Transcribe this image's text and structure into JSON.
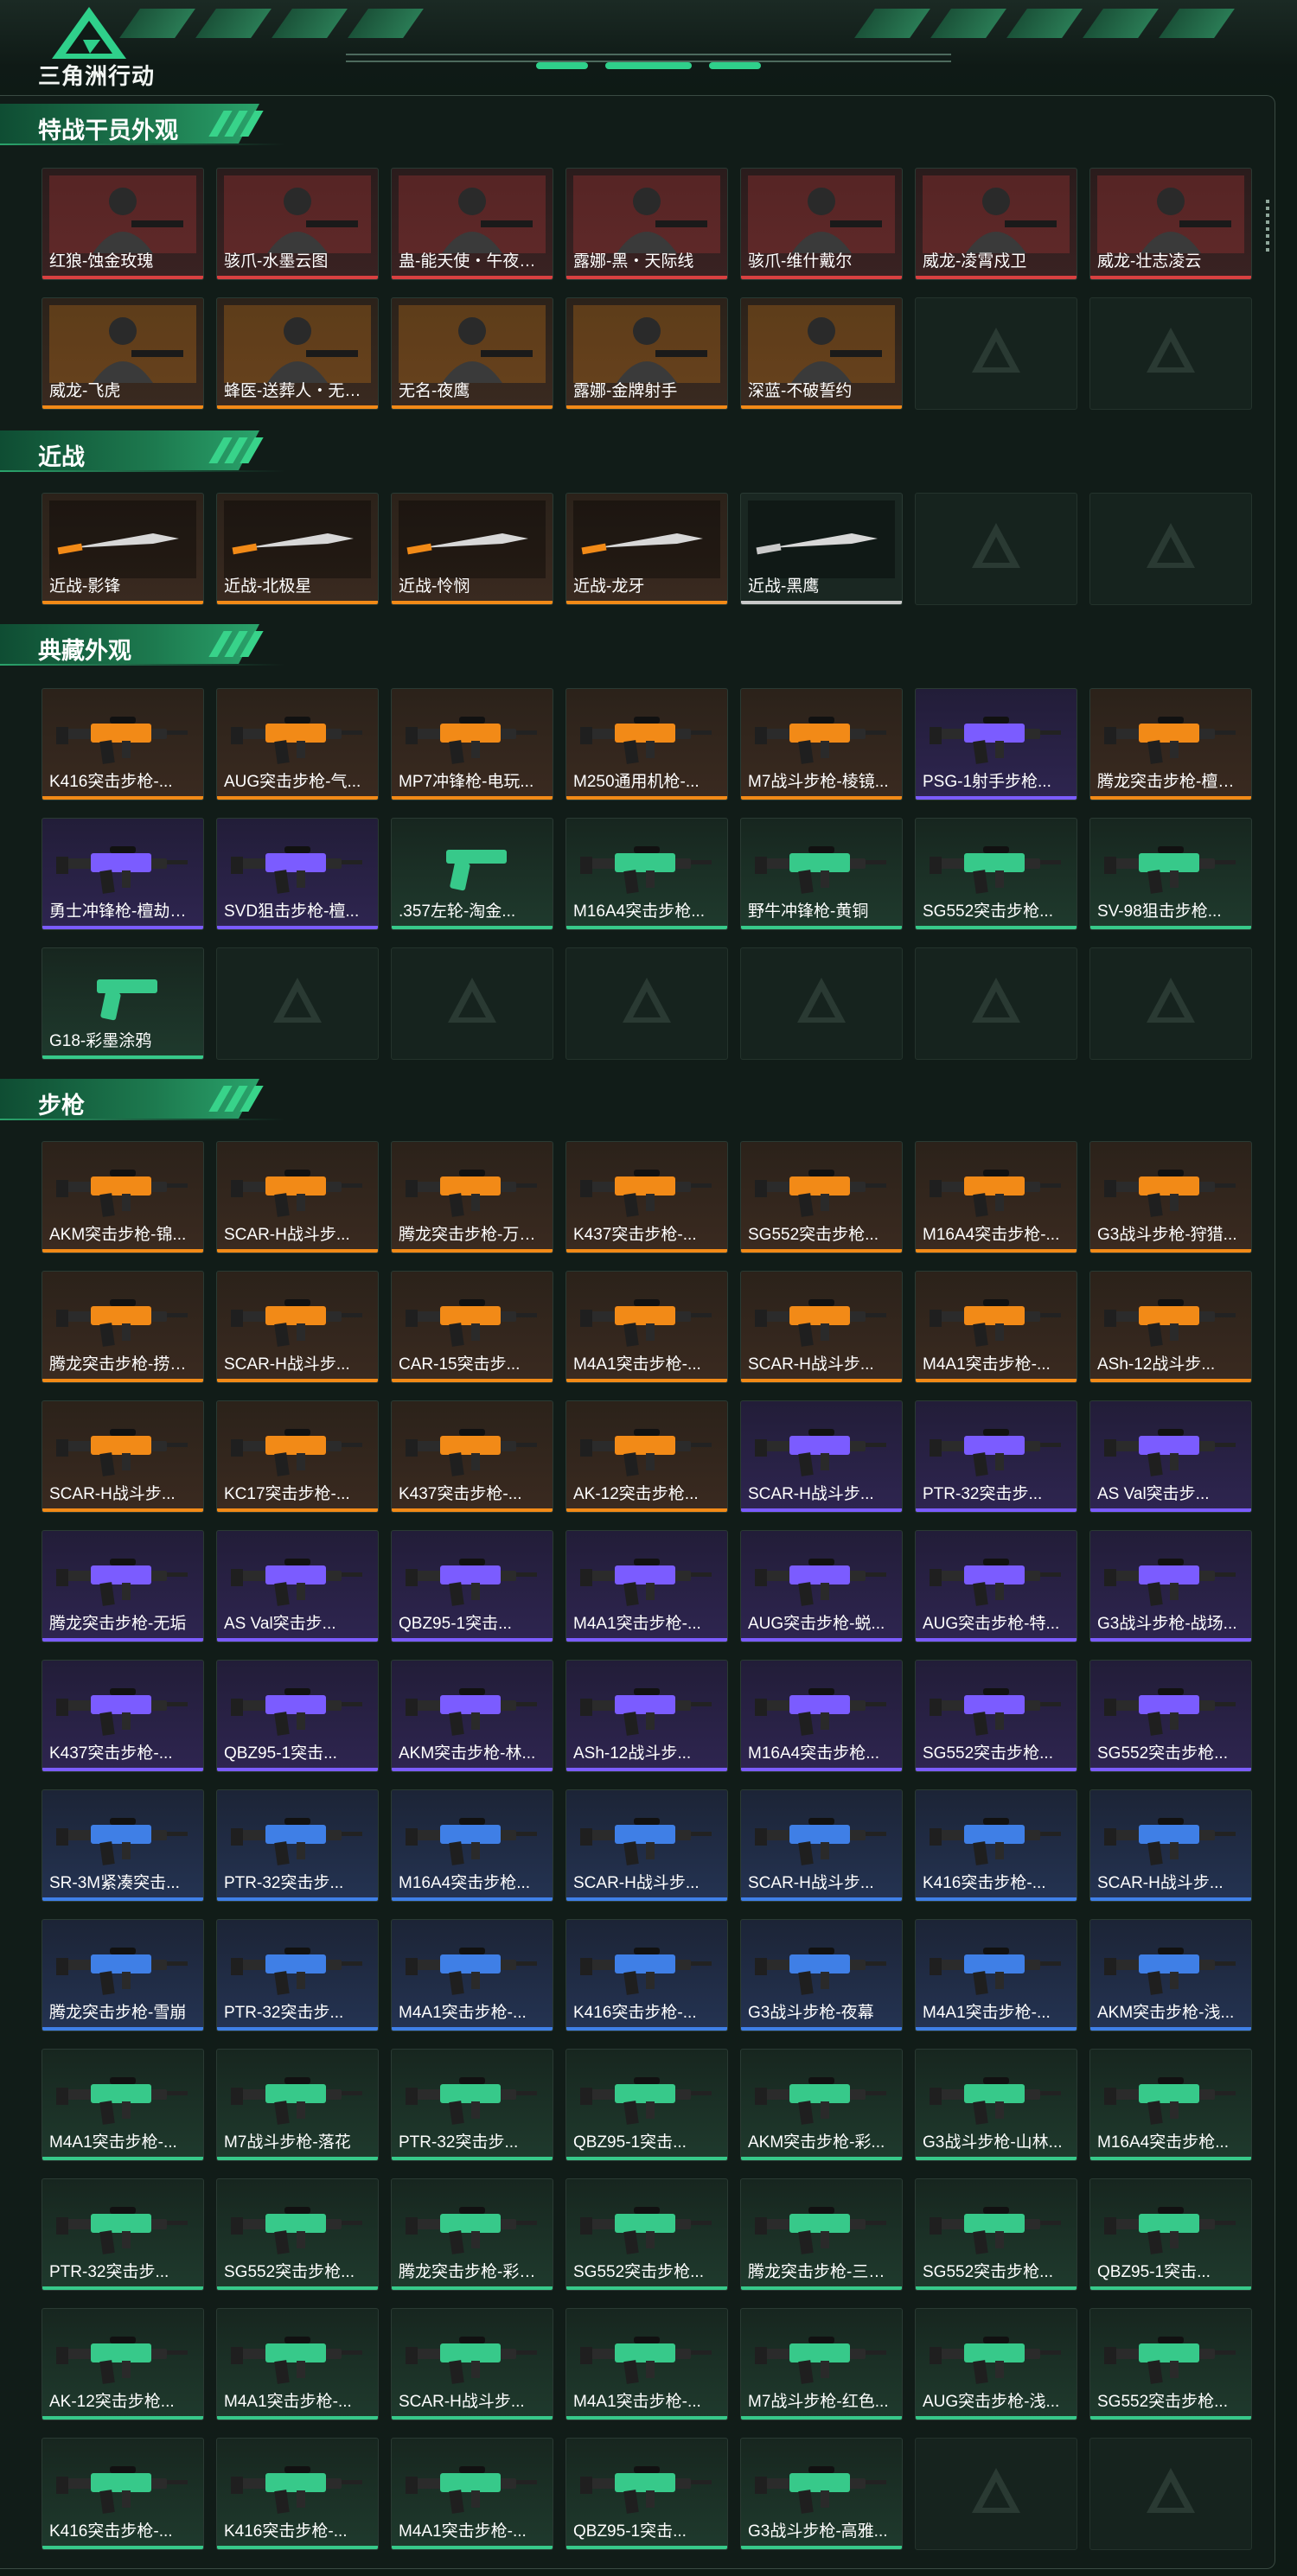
{
  "header": {
    "logo_text": "三角洲行动",
    "accent_color": "#2fd08b"
  },
  "sections": [
    {
      "key": "operators",
      "title": "特战干员外观",
      "items": [
        {
          "name": "红狼-蚀金玫瑰",
          "rarity": "red",
          "icon": "operator-portrait"
        },
        {
          "name": "骇爪-水墨云图",
          "rarity": "red",
          "icon": "operator-portrait"
        },
        {
          "name": "蛊-能天使・午夜邮...",
          "rarity": "red",
          "icon": "operator-portrait"
        },
        {
          "name": "露娜-黑・天际线",
          "rarity": "red",
          "icon": "operator-portrait"
        },
        {
          "name": "骇爪-维什戴尔",
          "rarity": "red",
          "icon": "operator-portrait"
        },
        {
          "name": "威龙-凌霄戍卫",
          "rarity": "red",
          "icon": "operator-portrait"
        },
        {
          "name": "威龙-壮志凌云",
          "rarity": "red",
          "icon": "operator-portrait"
        },
        {
          "name": "威龙-飞虎",
          "rarity": "gold",
          "icon": "operator-portrait"
        },
        {
          "name": "蜂医-送葬人・无题...",
          "rarity": "gold",
          "icon": "operator-portrait"
        },
        {
          "name": "无名-夜鹰",
          "rarity": "gold",
          "icon": "operator-portrait"
        },
        {
          "name": "露娜-金牌射手",
          "rarity": "gold",
          "icon": "operator-portrait"
        },
        {
          "name": "深蓝-不破誓约",
          "rarity": "gold",
          "icon": "operator-portrait"
        },
        {
          "empty": true
        },
        {
          "empty": true
        }
      ]
    },
    {
      "key": "melee",
      "title": "近战",
      "items": [
        {
          "name": "近战-影锋",
          "rarity": "gold",
          "icon": "knife"
        },
        {
          "name": "近战-北极星",
          "rarity": "gold",
          "icon": "knife"
        },
        {
          "name": "近战-怜悯",
          "rarity": "gold",
          "icon": "knife"
        },
        {
          "name": "近战-龙牙",
          "rarity": "gold",
          "icon": "knife"
        },
        {
          "name": "近战-黑鹰",
          "rarity": "gray",
          "icon": "knife"
        },
        {
          "empty": true
        },
        {
          "empty": true
        }
      ]
    },
    {
      "key": "collection",
      "title": "典藏外观",
      "items": [
        {
          "name": "K416突击步枪-...",
          "rarity": "gold",
          "icon": "rifle"
        },
        {
          "name": "AUG突击步枪-气...",
          "rarity": "gold",
          "icon": "rifle"
        },
        {
          "name": "MP7冲锋枪-电玩...",
          "rarity": "gold",
          "icon": "rifle"
        },
        {
          "name": "M250通用机枪-...",
          "rarity": "gold",
          "icon": "rifle"
        },
        {
          "name": "M7战斗步枪-棱镜...",
          "rarity": "gold",
          "icon": "rifle"
        },
        {
          "name": "PSG-1射手步枪...",
          "rarity": "purple",
          "icon": "rifle"
        },
        {
          "name": "腾龙突击步枪-檀劫...",
          "rarity": "gold",
          "icon": "rifle"
        },
        {
          "name": "勇士冲锋枪-檀劫镜...",
          "rarity": "purple",
          "icon": "rifle"
        },
        {
          "name": "SVD狙击步枪-檀...",
          "rarity": "purple",
          "icon": "rifle"
        },
        {
          "name": ".357左轮-淘金...",
          "rarity": "green",
          "icon": "revolver"
        },
        {
          "name": "M16A4突击步枪...",
          "rarity": "green",
          "icon": "rifle"
        },
        {
          "name": "野牛冲锋枪-黄铜",
          "rarity": "green",
          "icon": "rifle"
        },
        {
          "name": "SG552突击步枪...",
          "rarity": "green",
          "icon": "rifle"
        },
        {
          "name": "SV-98狙击步枪...",
          "rarity": "green",
          "icon": "rifle"
        },
        {
          "name": "G18-彩墨涂鸦",
          "rarity": "green",
          "icon": "pistol"
        },
        {
          "empty": true
        },
        {
          "empty": true
        },
        {
          "empty": true
        },
        {
          "empty": true
        },
        {
          "empty": true
        },
        {
          "empty": true
        }
      ]
    },
    {
      "key": "rifles",
      "title": "步枪",
      "items": [
        {
          "name": "AKM突击步枪-锦...",
          "rarity": "gold",
          "icon": "rifle"
        },
        {
          "name": "SCAR-H战斗步...",
          "rarity": "gold",
          "icon": "rifle"
        },
        {
          "name": "腾龙突击步枪-万金...",
          "rarity": "gold",
          "icon": "rifle"
        },
        {
          "name": "K437突击步枪-...",
          "rarity": "gold",
          "icon": "rifle"
        },
        {
          "name": "SG552突击步枪...",
          "rarity": "gold",
          "icon": "rifle"
        },
        {
          "name": "M16A4突击步枪-...",
          "rarity": "gold",
          "icon": "rifle"
        },
        {
          "name": "G3战斗步枪-狩猎...",
          "rarity": "gold",
          "icon": "rifle"
        },
        {
          "name": "腾龙突击步枪-捞点...",
          "rarity": "gold",
          "icon": "rifle"
        },
        {
          "name": "SCAR-H战斗步...",
          "rarity": "gold",
          "icon": "rifle"
        },
        {
          "name": "CAR-15突击步...",
          "rarity": "gold",
          "icon": "rifle"
        },
        {
          "name": "M4A1突击步枪-...",
          "rarity": "gold",
          "icon": "rifle"
        },
        {
          "name": "SCAR-H战斗步...",
          "rarity": "gold",
          "icon": "rifle"
        },
        {
          "name": "M4A1突击步枪-...",
          "rarity": "gold",
          "icon": "rifle"
        },
        {
          "name": "ASh-12战斗步...",
          "rarity": "gold",
          "icon": "rifle"
        },
        {
          "name": "SCAR-H战斗步...",
          "rarity": "gold",
          "icon": "rifle"
        },
        {
          "name": "KC17突击步枪-...",
          "rarity": "gold",
          "icon": "rifle"
        },
        {
          "name": "K437突击步枪-...",
          "rarity": "gold",
          "icon": "rifle"
        },
        {
          "name": "AK-12突击步枪...",
          "rarity": "gold",
          "icon": "rifle"
        },
        {
          "name": "SCAR-H战斗步...",
          "rarity": "purple",
          "icon": "rifle"
        },
        {
          "name": "PTR-32突击步...",
          "rarity": "purple",
          "icon": "rifle"
        },
        {
          "name": "AS Val突击步...",
          "rarity": "purple",
          "icon": "rifle"
        },
        {
          "name": "腾龙突击步枪-无垢",
          "rarity": "purple",
          "icon": "rifle"
        },
        {
          "name": "AS Val突击步...",
          "rarity": "purple",
          "icon": "rifle"
        },
        {
          "name": "QBZ95-1突击...",
          "rarity": "purple",
          "icon": "rifle"
        },
        {
          "name": "M4A1突击步枪-...",
          "rarity": "purple",
          "icon": "rifle"
        },
        {
          "name": "AUG突击步枪-蜕...",
          "rarity": "purple",
          "icon": "rifle"
        },
        {
          "name": "AUG突击步枪-特...",
          "rarity": "purple",
          "icon": "rifle"
        },
        {
          "name": "G3战斗步枪-战场...",
          "rarity": "purple",
          "icon": "rifle"
        },
        {
          "name": "K437突击步枪-...",
          "rarity": "purple",
          "icon": "rifle"
        },
        {
          "name": "QBZ95-1突击...",
          "rarity": "purple",
          "icon": "rifle"
        },
        {
          "name": "AKM突击步枪-林...",
          "rarity": "purple",
          "icon": "rifle"
        },
        {
          "name": "ASh-12战斗步...",
          "rarity": "purple",
          "icon": "rifle"
        },
        {
          "name": "M16A4突击步枪...",
          "rarity": "purple",
          "icon": "rifle"
        },
        {
          "name": "SG552突击步枪...",
          "rarity": "purple",
          "icon": "rifle"
        },
        {
          "name": "SG552突击步枪...",
          "rarity": "purple",
          "icon": "rifle"
        },
        {
          "name": "SR-3M紧凑突击...",
          "rarity": "blue",
          "icon": "rifle"
        },
        {
          "name": "PTR-32突击步...",
          "rarity": "blue",
          "icon": "rifle"
        },
        {
          "name": "M16A4突击步枪...",
          "rarity": "blue",
          "icon": "rifle"
        },
        {
          "name": "SCAR-H战斗步...",
          "rarity": "blue",
          "icon": "rifle"
        },
        {
          "name": "SCAR-H战斗步...",
          "rarity": "blue",
          "icon": "rifle"
        },
        {
          "name": "K416突击步枪-...",
          "rarity": "blue",
          "icon": "rifle"
        },
        {
          "name": "SCAR-H战斗步...",
          "rarity": "blue",
          "icon": "rifle"
        },
        {
          "name": "腾龙突击步枪-雪崩",
          "rarity": "blue",
          "icon": "rifle"
        },
        {
          "name": "PTR-32突击步...",
          "rarity": "blue",
          "icon": "rifle"
        },
        {
          "name": "M4A1突击步枪-...",
          "rarity": "blue",
          "icon": "rifle"
        },
        {
          "name": "K416突击步枪-...",
          "rarity": "blue",
          "icon": "rifle"
        },
        {
          "name": "G3战斗步枪-夜幕",
          "rarity": "blue",
          "icon": "rifle"
        },
        {
          "name": "M4A1突击步枪-...",
          "rarity": "blue",
          "icon": "rifle"
        },
        {
          "name": "AKM突击步枪-浅...",
          "rarity": "blue",
          "icon": "rifle"
        },
        {
          "name": "M4A1突击步枪-...",
          "rarity": "green",
          "icon": "rifle"
        },
        {
          "name": "M7战斗步枪-落花",
          "rarity": "green",
          "icon": "rifle"
        },
        {
          "name": "PTR-32突击步...",
          "rarity": "green",
          "icon": "rifle"
        },
        {
          "name": "QBZ95-1突击...",
          "rarity": "green",
          "icon": "rifle"
        },
        {
          "name": "AKM突击步枪-彩...",
          "rarity": "green",
          "icon": "rifle"
        },
        {
          "name": "G3战斗步枪-山林...",
          "rarity": "green",
          "icon": "rifle"
        },
        {
          "name": "M16A4突击步枪...",
          "rarity": "green",
          "icon": "rifle"
        },
        {
          "name": "PTR-32突击步...",
          "rarity": "green",
          "icon": "rifle"
        },
        {
          "name": "SG552突击步枪...",
          "rarity": "green",
          "icon": "rifle"
        },
        {
          "name": "腾龙突击步枪-彩墨...",
          "rarity": "green",
          "icon": "rifle"
        },
        {
          "name": "SG552突击步枪...",
          "rarity": "green",
          "icon": "rifle"
        },
        {
          "name": "腾龙突击步枪-三角...",
          "rarity": "green",
          "icon": "rifle"
        },
        {
          "name": "SG552突击步枪...",
          "rarity": "green",
          "icon": "rifle"
        },
        {
          "name": "QBZ95-1突击...",
          "rarity": "green",
          "icon": "rifle"
        },
        {
          "name": "AK-12突击步枪...",
          "rarity": "green",
          "icon": "rifle"
        },
        {
          "name": "M4A1突击步枪-...",
          "rarity": "green",
          "icon": "rifle"
        },
        {
          "name": "SCAR-H战斗步...",
          "rarity": "green",
          "icon": "rifle"
        },
        {
          "name": "M4A1突击步枪-...",
          "rarity": "green",
          "icon": "rifle"
        },
        {
          "name": "M7战斗步枪-红色...",
          "rarity": "green",
          "icon": "rifle"
        },
        {
          "name": "AUG突击步枪-浅...",
          "rarity": "green",
          "icon": "rifle"
        },
        {
          "name": "SG552突击步枪...",
          "rarity": "green",
          "icon": "rifle"
        },
        {
          "name": "K416突击步枪-...",
          "rarity": "green",
          "icon": "rifle"
        },
        {
          "name": "K416突击步枪-...",
          "rarity": "green",
          "icon": "rifle"
        },
        {
          "name": "M4A1突击步枪-...",
          "rarity": "green",
          "icon": "rifle"
        },
        {
          "name": "QBZ95-1突击...",
          "rarity": "green",
          "icon": "rifle"
        },
        {
          "name": "G3战斗步枪-高雅...",
          "rarity": "green",
          "icon": "rifle"
        },
        {
          "empty": true
        },
        {
          "empty": true
        }
      ]
    }
  ],
  "rarity_colors": {
    "red": "#d94040",
    "gold": "#f28a17",
    "purple": "#7b5cff",
    "blue": "#3f7fe6",
    "green": "#37c98a",
    "gray": "#c9c9c9"
  }
}
